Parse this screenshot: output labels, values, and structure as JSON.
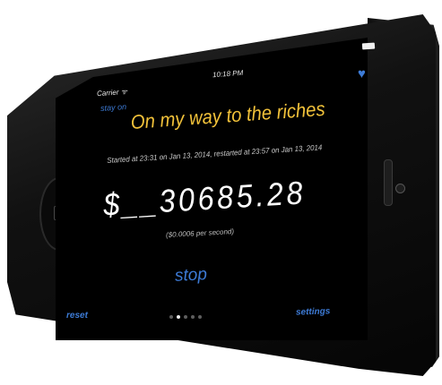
{
  "status_bar": {
    "carrier": "Carrier ᯤ",
    "time": "10:18 PM"
  },
  "toolbar": {
    "stay_on_label": "stay on",
    "favorite_icon": "heart-icon"
  },
  "main": {
    "title": "On my way to the riches",
    "subtitle": "Started at 23:31 on Jan 13, 2014, restarted at 23:57 on Jan 13, 2014",
    "amount_prefix": "$__",
    "amount_value": "30685.28",
    "rate": "($0.0006 per second)",
    "stop_label": "stop"
  },
  "footer": {
    "reset_label": "reset",
    "settings_label": "settings",
    "page_count": 5,
    "active_page": 1
  },
  "colors": {
    "accent_blue": "#3d7bd6",
    "title_yellow": "#f2c23a",
    "screen_bg": "#000000"
  }
}
